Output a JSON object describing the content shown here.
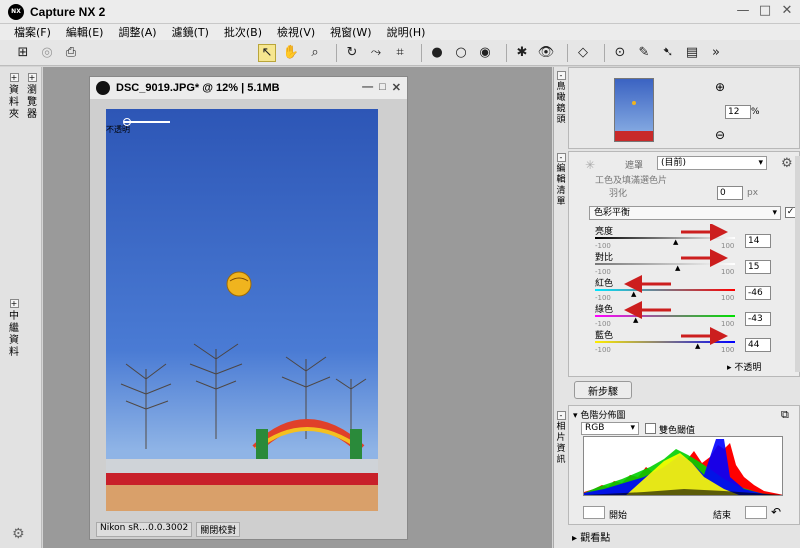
{
  "app": {
    "title": "Capture NX 2",
    "logo_text": "NX"
  },
  "window_controls": {
    "min": "—",
    "max": "□",
    "close": "✕"
  },
  "menu": [
    "檔案(F)",
    "編輯(E)",
    "調整(A)",
    "濾鏡(T)",
    "批次(B)",
    "檢視(V)",
    "視窗(W)",
    "說明(H)"
  ],
  "left_strip": {
    "panel1": "資料夾",
    "panel2": "瀏覽器",
    "panel3": "中繼資料"
  },
  "document": {
    "title": "DSC_9019.JPG* @ 12% | 5.1MB",
    "status_model": "Nikon sR…0.0.3002",
    "status_profile": "關閉校對",
    "watermark_label": "不透明"
  },
  "birdseye": {
    "label": "鳥瞰鏡頭",
    "zoom_value": "12",
    "zoom_unit": "%"
  },
  "edit_list": {
    "label": "編輯清單",
    "mode_label": "遮罩",
    "mode_value": "(目前)",
    "feather_label": "羽化",
    "feather_value": "0",
    "feather_unit": "px",
    "clipped_header": "工色及填滿選色片",
    "color_balance": "色彩平衡",
    "sliders": [
      {
        "label": "亮度",
        "min": "-100",
        "max": "100",
        "value": "14"
      },
      {
        "label": "對比",
        "min": "-100",
        "max": "100",
        "value": "15"
      },
      {
        "label": "紅色",
        "min": "-100",
        "max": "100",
        "value": "-46"
      },
      {
        "label": "綠色",
        "min": "-100",
        "max": "100",
        "value": "-43"
      },
      {
        "label": "藍色",
        "min": "-100",
        "max": "100",
        "value": "44"
      }
    ],
    "opacity_label": "不透明",
    "new_step": "新步驟"
  },
  "photo_info": {
    "side_label": "相片資訊",
    "histogram_title": "色階分佈圖",
    "channel": "RGB",
    "dual_label": "雙色閾值",
    "start_label": "開始",
    "end_label": "結束"
  },
  "viewpoint": "觀看點",
  "colors": {
    "arrow": "#cc1e1e",
    "sky": "#3a66c6",
    "accent": "#f6e68f"
  }
}
